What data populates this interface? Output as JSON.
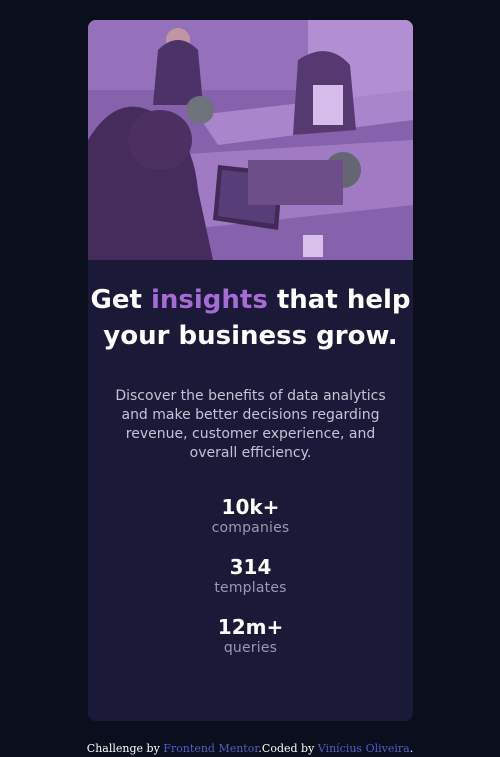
{
  "card": {
    "headline_start": "Get",
    "headline_accent": "insights",
    "headline_end": "that help your business grow.",
    "description": "Discover the benefits of data analytics and make better decisions regarding revenue, customer experience, and overall efficiency.",
    "stats": [
      {
        "value": "10k+",
        "label": "companies"
      },
      {
        "value": "314",
        "label": "templates"
      },
      {
        "value": "12m+",
        "label": "queries"
      }
    ]
  },
  "footer": {
    "prefix": "Challenge by",
    "frontend_mentor": "Frontend Mentor",
    "middle": ".Coded by",
    "author": "Vinícius Oliveira",
    "suffix": "."
  },
  "colors": {
    "page_bg": "#0b0e1d",
    "card_bg": "#1b1938",
    "accent": "#a66bd4",
    "link": "#4e5ec6"
  }
}
